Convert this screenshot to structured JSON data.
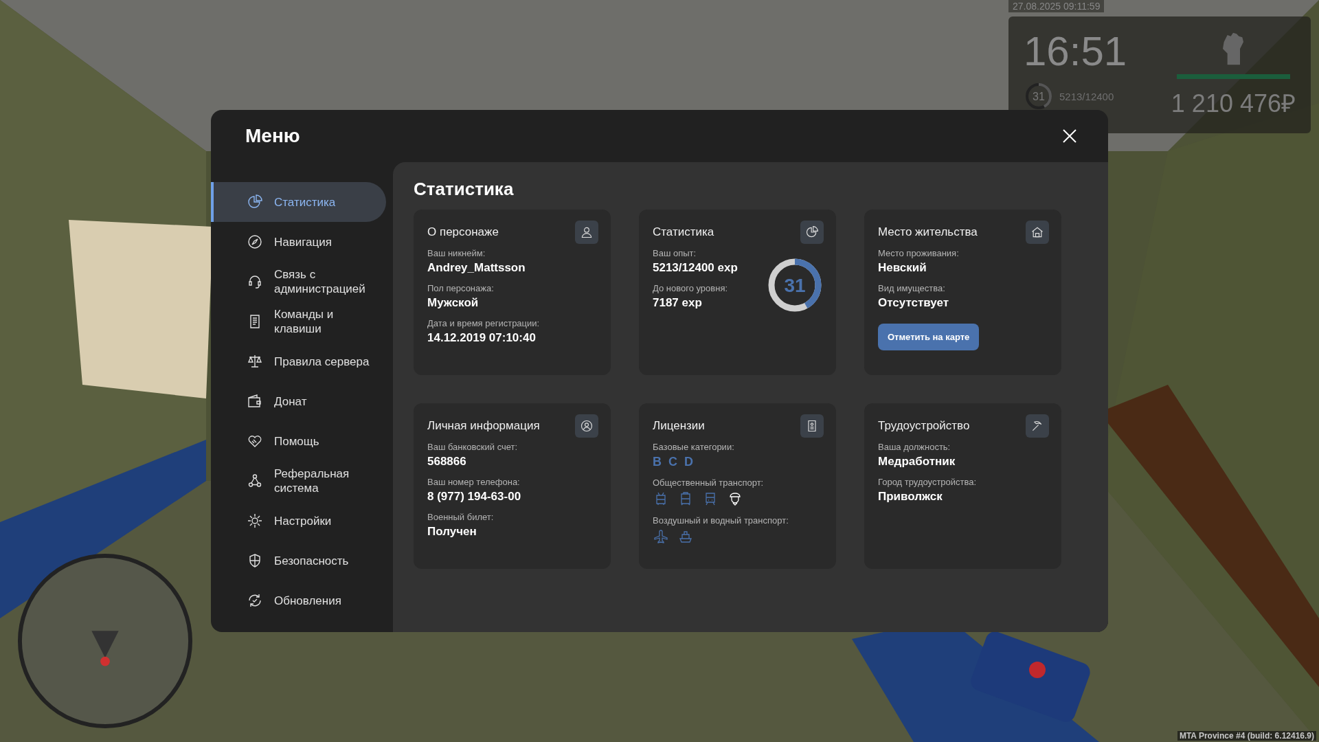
{
  "hud": {
    "date": "27.08.2025 09:11:59",
    "clock": "16:51",
    "level": {
      "value": "31",
      "level": 0.42
    },
    "exp": "5213/12400",
    "health": {
      "level": 1
    },
    "money": "1 210 476₽",
    "build": "MTA Province #4 (build: 6.12416.9)"
  },
  "menu": {
    "title": "Меню",
    "nav": [
      {
        "label": "Статистика",
        "selected": true
      },
      {
        "label": "Навигация",
        "selected": false
      },
      {
        "label": "Связь с администрацией",
        "selected": false
      },
      {
        "label": "Команды и клавиши",
        "selected": false
      },
      {
        "label": "Правила сервера",
        "selected": false
      },
      {
        "label": "Донат",
        "selected": false
      },
      {
        "label": "Помощь",
        "selected": false
      },
      {
        "label": "Реферальная система",
        "selected": false
      },
      {
        "label": "Настройки",
        "selected": false
      },
      {
        "label": "Безопасность",
        "selected": false
      },
      {
        "label": "Обновления",
        "selected": false
      }
    ],
    "page_title": "Статистика",
    "cards": [
      {
        "kind": "info",
        "title": "О персонаже",
        "fields": [
          {
            "label": "Ваш никнейм:",
            "value": "Andrey_Mattsson"
          },
          {
            "label": "Пол персонажа:",
            "value": "Мужской"
          },
          {
            "label": "Дата и время регистрации:",
            "value": "14.12.2019 07:10:40"
          }
        ]
      },
      {
        "kind": "stats",
        "title": "Статистика",
        "fields": [
          {
            "label": "Ваш опыт:",
            "value": "5213/12400 exp"
          },
          {
            "label": "До нового уровня:",
            "value": "7187 exp"
          }
        ],
        "ring": {
          "value": "31",
          "level": 0.42
        }
      },
      {
        "kind": "residence",
        "title": "Место жительства",
        "fields": [
          {
            "label": "Место проживания:",
            "value": "Невский"
          },
          {
            "label": "Вид имущества:",
            "value": "Отсутствует"
          }
        ],
        "button": "Отметить на карте"
      },
      {
        "kind": "info",
        "title": "Личная информация",
        "fields": [
          {
            "label": "Ваш банковский счет:",
            "value": "568866"
          },
          {
            "label": "Ваш номер телефона:",
            "value": "8 (977) 194-63-00"
          },
          {
            "label": "Военный билет:",
            "value": "Получен"
          }
        ]
      },
      {
        "kind": "licenses",
        "title": "Лицензии",
        "sections": [
          {
            "kind": "letters",
            "label": "Базовые категории:",
            "items": [
              "B",
              "C",
              "D"
            ]
          },
          {
            "kind": "icons",
            "label": "Общественный транспорт:",
            "items": [
              {
                "owned": true
              },
              {
                "owned": true
              },
              {
                "owned": true
              },
              {
                "owned": false
              }
            ]
          },
          {
            "kind": "icons",
            "label": "Воздушный и водный транспорт:",
            "items": [
              {
                "owned": true
              },
              {
                "owned": true
              }
            ]
          }
        ]
      },
      {
        "kind": "info",
        "title": "Трудоустройство",
        "fields": [
          {
            "label": "Ваша должность:",
            "value": "Медработник"
          },
          {
            "label": "Город трудоустройства:",
            "value": "Приволжск"
          }
        ]
      }
    ]
  }
}
